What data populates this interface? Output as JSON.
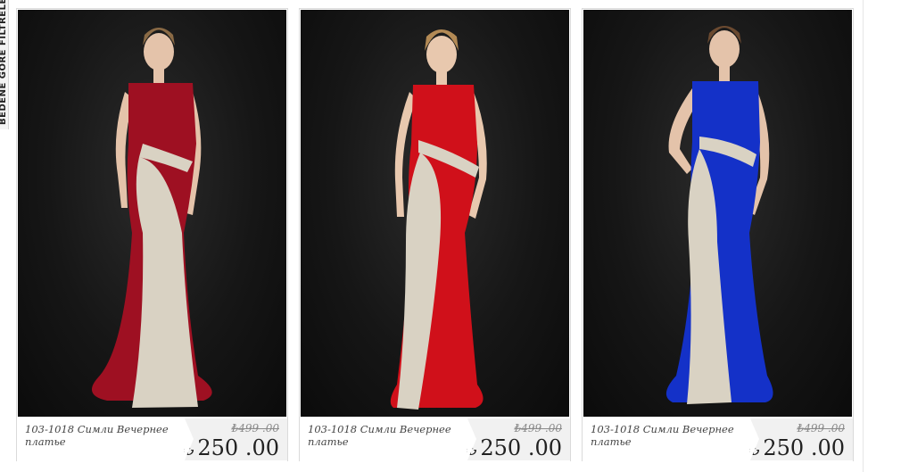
{
  "side_tab": {
    "label": "BEDENE GÖRE FİLTRELE"
  },
  "products": [
    {
      "name": "103-1018 Симли Вечернее платье",
      "old_price": "₺499 .00",
      "currency": "₺",
      "price": "250 .00",
      "dress_color": "#9e1022",
      "accent_color": "#d9d2c3"
    },
    {
      "name": "103-1018 Симли Вечернее платье",
      "old_price": "₺499 .00",
      "currency": "₺",
      "price": "250 .00",
      "dress_color": "#d0101a",
      "accent_color": "#d9d2c3"
    },
    {
      "name": "103-1018 Симли Вечернее платье",
      "old_price": "₺499 .00",
      "currency": "₺",
      "price": "250 .00",
      "dress_color": "#1431c8",
      "accent_color": "#d9d2c3"
    }
  ]
}
